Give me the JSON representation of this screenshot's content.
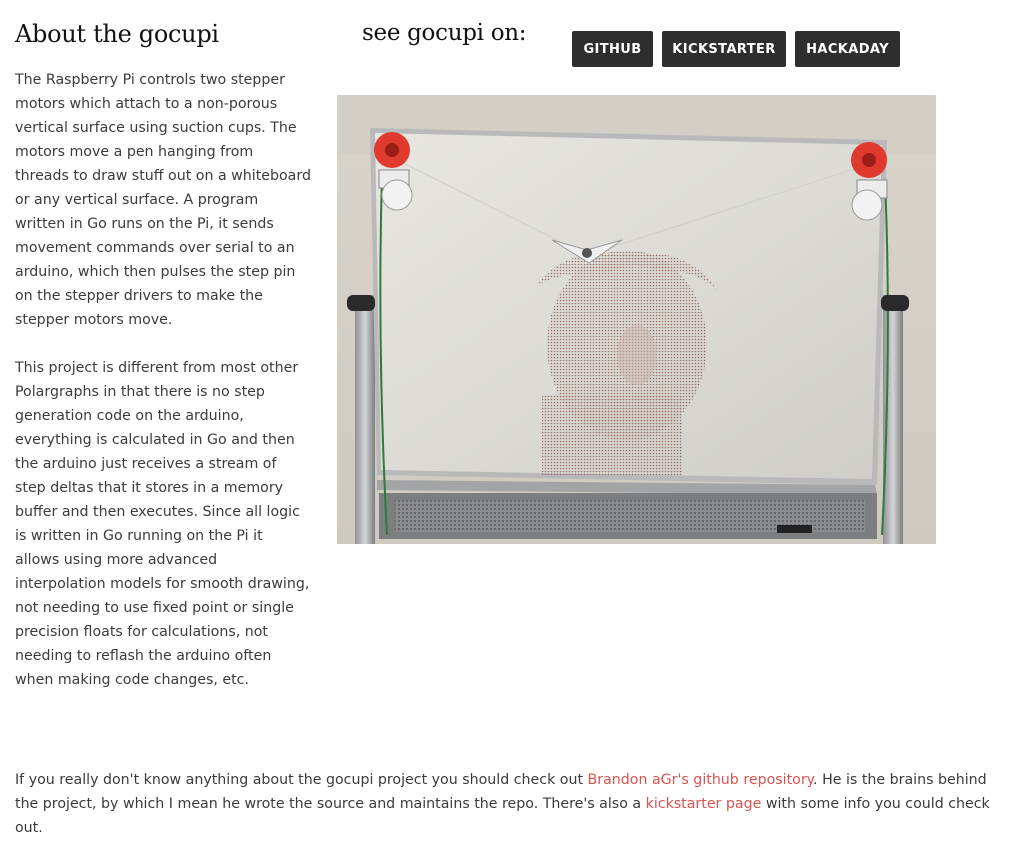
{
  "about": {
    "title": "About the gocupi",
    "paragraph1": "The Raspberry Pi controls two stepper motors which attach to a non-porous vertical surface using suction cups. The motors move a pen hanging from threads to draw stuff out on a whiteboard or any vertical surface. A program written in Go runs on the Pi, it sends movement commands over serial to an arduino, which then pulses the step pin on the stepper drivers to make the stepper motors move.",
    "paragraph2": "This project is different from most other Polargraphs in that there is no step generation code on the arduino, everything is calculated in Go and then the arduino just receives a stream of step deltas that it stores in a memory buffer and then executes. Since all logic is written in Go running on the Pi it allows using more advanced interpolation models for smooth drawing, not needing to use fixed point or single precision floats for calculations, not needing to reflash the arduino often when making code changes, etc."
  },
  "links": {
    "title": "see gocupi on:",
    "buttons": [
      "GITHUB",
      "KICKSTARTER",
      "HACKADAY"
    ]
  },
  "photo": {
    "subject": "whiteboard with polargraph drawing",
    "accent": "#e03a2f"
  },
  "footer": {
    "text1": "If you really don't know anything about the gocupi project you should check out ",
    "link1": "Brandon aGr's github repository",
    "text2": ". He is the brains behind the project, by which I mean he wrote the source and maintains the repo. There's also a ",
    "link2": "kickstarter page",
    "text3": " with some info you could check out.",
    "link_color": "#d9534f"
  }
}
